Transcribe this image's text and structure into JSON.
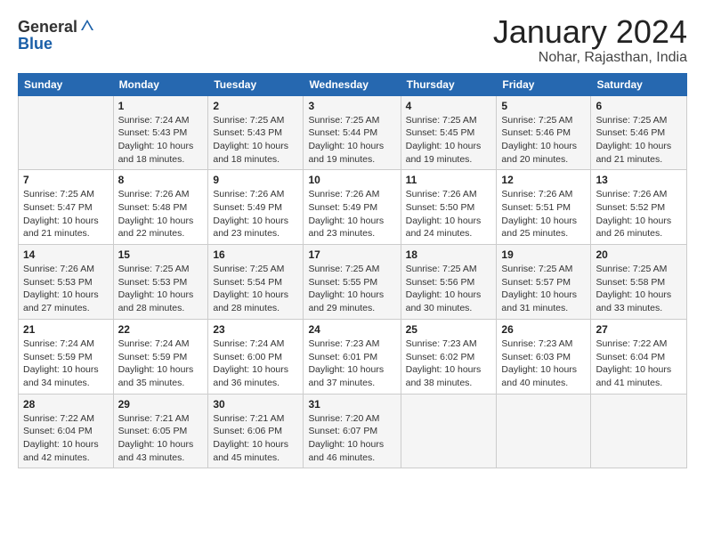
{
  "header": {
    "logo_general": "General",
    "logo_blue": "Blue",
    "month_year": "January 2024",
    "location": "Nohar, Rajasthan, India"
  },
  "days_of_week": [
    "Sunday",
    "Monday",
    "Tuesday",
    "Wednesday",
    "Thursday",
    "Friday",
    "Saturday"
  ],
  "weeks": [
    [
      {
        "day": "",
        "info": ""
      },
      {
        "day": "1",
        "info": "Sunrise: 7:24 AM\nSunset: 5:43 PM\nDaylight: 10 hours\nand 18 minutes."
      },
      {
        "day": "2",
        "info": "Sunrise: 7:25 AM\nSunset: 5:43 PM\nDaylight: 10 hours\nand 18 minutes."
      },
      {
        "day": "3",
        "info": "Sunrise: 7:25 AM\nSunset: 5:44 PM\nDaylight: 10 hours\nand 19 minutes."
      },
      {
        "day": "4",
        "info": "Sunrise: 7:25 AM\nSunset: 5:45 PM\nDaylight: 10 hours\nand 19 minutes."
      },
      {
        "day": "5",
        "info": "Sunrise: 7:25 AM\nSunset: 5:46 PM\nDaylight: 10 hours\nand 20 minutes."
      },
      {
        "day": "6",
        "info": "Sunrise: 7:25 AM\nSunset: 5:46 PM\nDaylight: 10 hours\nand 21 minutes."
      }
    ],
    [
      {
        "day": "7",
        "info": "Sunrise: 7:25 AM\nSunset: 5:47 PM\nDaylight: 10 hours\nand 21 minutes."
      },
      {
        "day": "8",
        "info": "Sunrise: 7:26 AM\nSunset: 5:48 PM\nDaylight: 10 hours\nand 22 minutes."
      },
      {
        "day": "9",
        "info": "Sunrise: 7:26 AM\nSunset: 5:49 PM\nDaylight: 10 hours\nand 23 minutes."
      },
      {
        "day": "10",
        "info": "Sunrise: 7:26 AM\nSunset: 5:49 PM\nDaylight: 10 hours\nand 23 minutes."
      },
      {
        "day": "11",
        "info": "Sunrise: 7:26 AM\nSunset: 5:50 PM\nDaylight: 10 hours\nand 24 minutes."
      },
      {
        "day": "12",
        "info": "Sunrise: 7:26 AM\nSunset: 5:51 PM\nDaylight: 10 hours\nand 25 minutes."
      },
      {
        "day": "13",
        "info": "Sunrise: 7:26 AM\nSunset: 5:52 PM\nDaylight: 10 hours\nand 26 minutes."
      }
    ],
    [
      {
        "day": "14",
        "info": "Sunrise: 7:26 AM\nSunset: 5:53 PM\nDaylight: 10 hours\nand 27 minutes."
      },
      {
        "day": "15",
        "info": "Sunrise: 7:25 AM\nSunset: 5:53 PM\nDaylight: 10 hours\nand 28 minutes."
      },
      {
        "day": "16",
        "info": "Sunrise: 7:25 AM\nSunset: 5:54 PM\nDaylight: 10 hours\nand 28 minutes."
      },
      {
        "day": "17",
        "info": "Sunrise: 7:25 AM\nSunset: 5:55 PM\nDaylight: 10 hours\nand 29 minutes."
      },
      {
        "day": "18",
        "info": "Sunrise: 7:25 AM\nSunset: 5:56 PM\nDaylight: 10 hours\nand 30 minutes."
      },
      {
        "day": "19",
        "info": "Sunrise: 7:25 AM\nSunset: 5:57 PM\nDaylight: 10 hours\nand 31 minutes."
      },
      {
        "day": "20",
        "info": "Sunrise: 7:25 AM\nSunset: 5:58 PM\nDaylight: 10 hours\nand 33 minutes."
      }
    ],
    [
      {
        "day": "21",
        "info": "Sunrise: 7:24 AM\nSunset: 5:59 PM\nDaylight: 10 hours\nand 34 minutes."
      },
      {
        "day": "22",
        "info": "Sunrise: 7:24 AM\nSunset: 5:59 PM\nDaylight: 10 hours\nand 35 minutes."
      },
      {
        "day": "23",
        "info": "Sunrise: 7:24 AM\nSunset: 6:00 PM\nDaylight: 10 hours\nand 36 minutes."
      },
      {
        "day": "24",
        "info": "Sunrise: 7:23 AM\nSunset: 6:01 PM\nDaylight: 10 hours\nand 37 minutes."
      },
      {
        "day": "25",
        "info": "Sunrise: 7:23 AM\nSunset: 6:02 PM\nDaylight: 10 hours\nand 38 minutes."
      },
      {
        "day": "26",
        "info": "Sunrise: 7:23 AM\nSunset: 6:03 PM\nDaylight: 10 hours\nand 40 minutes."
      },
      {
        "day": "27",
        "info": "Sunrise: 7:22 AM\nSunset: 6:04 PM\nDaylight: 10 hours\nand 41 minutes."
      }
    ],
    [
      {
        "day": "28",
        "info": "Sunrise: 7:22 AM\nSunset: 6:04 PM\nDaylight: 10 hours\nand 42 minutes."
      },
      {
        "day": "29",
        "info": "Sunrise: 7:21 AM\nSunset: 6:05 PM\nDaylight: 10 hours\nand 43 minutes."
      },
      {
        "day": "30",
        "info": "Sunrise: 7:21 AM\nSunset: 6:06 PM\nDaylight: 10 hours\nand 45 minutes."
      },
      {
        "day": "31",
        "info": "Sunrise: 7:20 AM\nSunset: 6:07 PM\nDaylight: 10 hours\nand 46 minutes."
      },
      {
        "day": "",
        "info": ""
      },
      {
        "day": "",
        "info": ""
      },
      {
        "day": "",
        "info": ""
      }
    ]
  ]
}
